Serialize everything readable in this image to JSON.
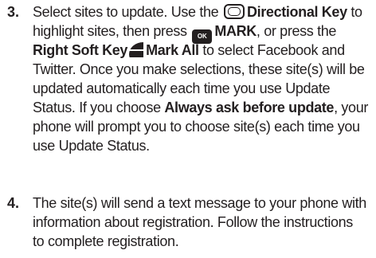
{
  "steps": [
    {
      "number": "3.",
      "line1_a": "Select sites to update. Use the ",
      "line1_b": "Directional Key",
      "line1_c": " to",
      "line2_a": "highlight sites, then press ",
      "ok_icon_label": "OK",
      "line2_b": "MARK",
      "line2_c": ", or press the",
      "line3_a": "Right Soft Key",
      "line3_b": "Mark All",
      "line3_c": " to select Facebook and",
      "line4": "Twitter. Once you make selections, these site(s) will be",
      "line5": "updated automatically each time you use Update",
      "line6_a": "Status. If you choose ",
      "line6_b": "Always ask before update",
      "line6_c": ", your",
      "line7": "phone will prompt you to choose site(s) each time you",
      "line8": "use Update Status."
    },
    {
      "number": "4.",
      "line1": "The site(s) will send a text message to your phone with",
      "line2": "information about registration. Follow the instructions",
      "line3": "to complete registration."
    }
  ],
  "icons": {
    "directional_key": "directional-key-icon",
    "ok_key": "ok-key-icon",
    "right_soft_key": "right-soft-key-icon"
  }
}
